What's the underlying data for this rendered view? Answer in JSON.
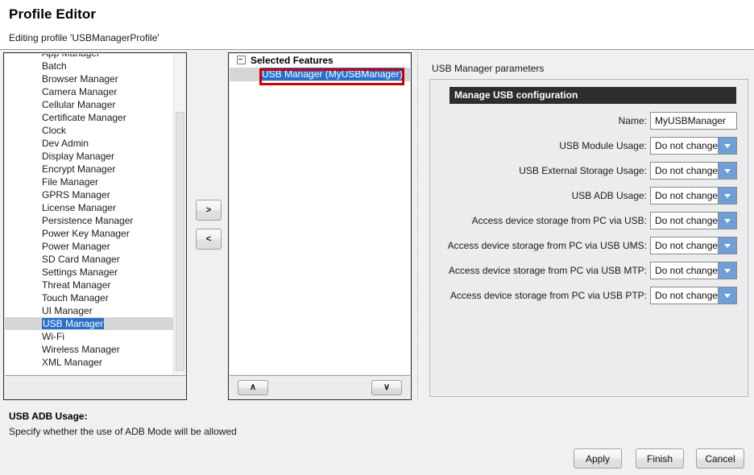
{
  "header": {
    "title": "Profile Editor",
    "subtitle": "Editing profile 'USBManagerProfile'"
  },
  "available_features": {
    "items": [
      {
        "label": "App Manager",
        "selected": false
      },
      {
        "label": "Batch",
        "selected": false
      },
      {
        "label": "Browser Manager",
        "selected": false
      },
      {
        "label": "Camera Manager",
        "selected": false
      },
      {
        "label": "Cellular Manager",
        "selected": false
      },
      {
        "label": "Certificate Manager",
        "selected": false
      },
      {
        "label": "Clock",
        "selected": false
      },
      {
        "label": "Dev Admin",
        "selected": false
      },
      {
        "label": "Display Manager",
        "selected": false
      },
      {
        "label": "Encrypt Manager",
        "selected": false
      },
      {
        "label": "File Manager",
        "selected": false
      },
      {
        "label": "GPRS Manager",
        "selected": false
      },
      {
        "label": "License Manager",
        "selected": false
      },
      {
        "label": "Persistence Manager",
        "selected": false
      },
      {
        "label": "Power Key Manager",
        "selected": false
      },
      {
        "label": "Power Manager",
        "selected": false
      },
      {
        "label": "SD Card Manager",
        "selected": false
      },
      {
        "label": "Settings Manager",
        "selected": false
      },
      {
        "label": "Threat Manager",
        "selected": false
      },
      {
        "label": "Touch Manager",
        "selected": false
      },
      {
        "label": "UI Manager",
        "selected": false
      },
      {
        "label": "USB Manager",
        "selected": true
      },
      {
        "label": "Wi-Fi",
        "selected": false
      },
      {
        "label": "Wireless Manager",
        "selected": false
      },
      {
        "label": "XML Manager",
        "selected": false
      }
    ]
  },
  "transfer": {
    "add_label": ">",
    "remove_label": "<"
  },
  "selected_features": {
    "root_label": "Selected Features",
    "child_label": "USB Manager (MyUSBManager)",
    "move_up_label": "∧",
    "move_down_label": "∨"
  },
  "parameters": {
    "panel_title": "USB Manager parameters",
    "group_title": "Manage USB configuration",
    "rows": [
      {
        "label": "Name:",
        "type": "text",
        "value": "MyUSBManager"
      },
      {
        "label": "USB Module Usage:",
        "type": "combo",
        "value": "Do not change"
      },
      {
        "label": "USB External Storage Usage:",
        "type": "combo",
        "value": "Do not change"
      },
      {
        "label": "USB ADB Usage:",
        "type": "combo",
        "value": "Do not change"
      },
      {
        "label": "Access device storage from PC via USB:",
        "type": "combo",
        "value": "Do not change"
      },
      {
        "label": "Access device storage from PC via USB UMS:",
        "type": "combo",
        "value": "Do not change"
      },
      {
        "label": "Access device storage from PC via USB MTP:",
        "type": "combo",
        "value": "Do not change"
      },
      {
        "label": "Access device storage from PC via USB PTP:",
        "type": "combo",
        "value": "Do not change"
      }
    ]
  },
  "help": {
    "title": "USB ADB Usage:",
    "text": "Specify whether the use of ADB Mode will be allowed"
  },
  "footer": {
    "apply_label": "Apply",
    "finish_label": "Finish",
    "cancel_label": "Cancel"
  },
  "colors": {
    "selection_blue": "#2a6fc9",
    "annotation_red": "#cc0000",
    "group_header_bg": "#2d2d2d",
    "combo_arrow_blue": "#6f9fd8"
  }
}
